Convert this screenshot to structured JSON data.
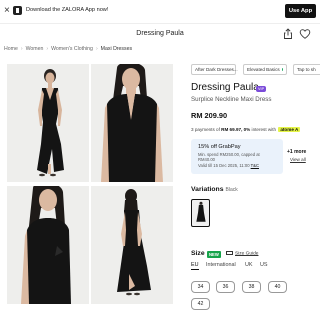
{
  "banner": {
    "close_label": "×",
    "text": "Download the ZALORA App now!",
    "use_app_label": "Use App"
  },
  "header": {
    "title": "Dressing Paula"
  },
  "breadcrumb": [
    "Home",
    "Women",
    "Women's Clothing",
    "Maxi Dresses"
  ],
  "chips": [
    "After Dark Dresses...",
    "Elevated Basics",
    "Tap to sh"
  ],
  "product": {
    "brand": "Dressing Paula",
    "vip_badge": "VIP",
    "name": "Surplice Neckline Maxi Dress",
    "price": "RM 209.90",
    "installment_prefix": "3 payments of ",
    "installment_amount": "RM 69.97",
    "installment_rate": ", 0%",
    "installment_suffix": " interest with",
    "installment_provider": "atome A"
  },
  "promo": {
    "title": "15% off GrabPay",
    "desc_1": "Min. spend RM250.00, capped at",
    "desc_2": "RM40.00",
    "desc_3": "Valid till 15 Dec 2025, 11:00",
    "tnc": "T&C",
    "more": "+1 more",
    "view_all": "View all"
  },
  "variations": {
    "label": "Variations",
    "selected": "Black"
  },
  "size": {
    "label": "Size",
    "new_badge": "NEW",
    "guide_label": "Size Guide",
    "tabs": [
      "EU",
      "International",
      "UK",
      "US"
    ],
    "options": [
      "34",
      "36",
      "38",
      "40",
      "42"
    ]
  },
  "colors": {
    "accent_vip": "#7b4cd9",
    "new_badge": "#16a34a",
    "promo_bg": "#eaf2fb",
    "dress": "#141414"
  }
}
